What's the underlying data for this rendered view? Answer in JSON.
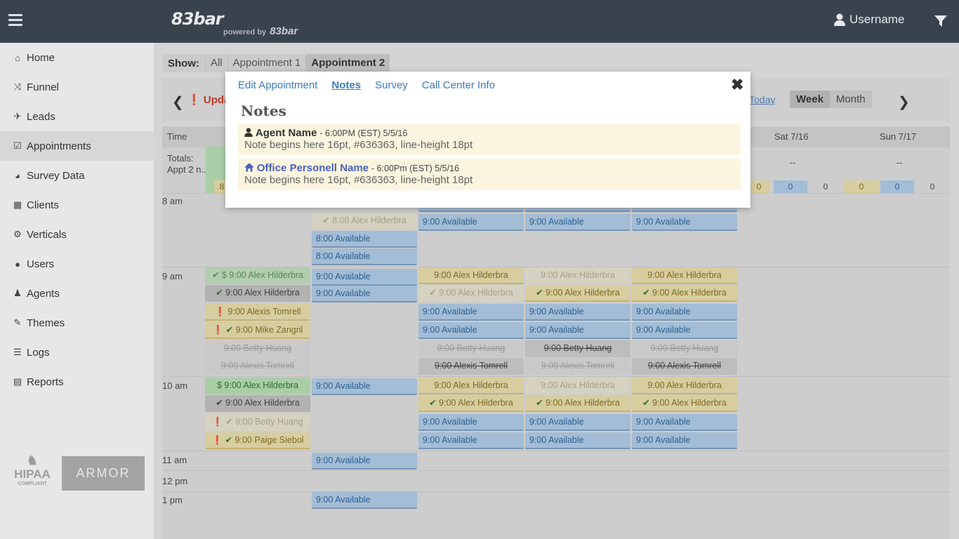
{
  "header": {
    "brand": "83bar",
    "powered_label": "powered by",
    "powered_brand": "83bar",
    "username": "Username",
    "menu_icon": "hamburger-icon",
    "user_icon": "user-icon",
    "filter_icon": "filter-icon"
  },
  "sidebar": {
    "items": [
      {
        "label": "Home",
        "icon": "home-icon"
      },
      {
        "label": "Funnel",
        "icon": "shuffle-icon"
      },
      {
        "label": "Leads",
        "icon": "plane-icon"
      },
      {
        "label": "Appointments",
        "icon": "calendar-check-icon"
      },
      {
        "label": "Survey Data",
        "icon": "pie-chart-icon"
      },
      {
        "label": "Clients",
        "icon": "building-icon"
      },
      {
        "label": "Verticals",
        "icon": "cogs-icon"
      },
      {
        "label": "Users",
        "icon": "users-icon"
      },
      {
        "label": "Agents",
        "icon": "user-tie-icon"
      },
      {
        "label": "Themes",
        "icon": "brush-icon"
      },
      {
        "label": "Logs",
        "icon": "list-icon"
      },
      {
        "label": "Reports",
        "icon": "file-icon"
      }
    ],
    "hipaa": "HIPAA",
    "hipaa_sub": "COMPLIANT",
    "armor": "ARMOR"
  },
  "show": {
    "label": "Show:",
    "options": [
      "All",
      "Appointment 1",
      "Appointment 2"
    ]
  },
  "calbar": {
    "update_text": "Upda",
    "today": "Today",
    "views": [
      "Week",
      "Month"
    ]
  },
  "grid": {
    "time_header": "Time",
    "day_headers": [
      "Sat 7/16",
      "Sun 7/17"
    ],
    "totals_label": "Totals:",
    "totals_sub": "Appt 2 n...",
    "dash": "--",
    "totals_values": [
      "0",
      "0",
      "0",
      "0",
      "0",
      "0"
    ],
    "partial_total": "8",
    "times": [
      "8 am",
      "9 am",
      "10 am",
      "11 am",
      "12 pm",
      "1 pm"
    ],
    "ev": {
      "a8a": "8:00 Alex Hilderbra",
      "av8": "8:00 Available",
      "av9": "9:00 Available",
      "alex": "9:00 Alex Hilderbra",
      "alexis": "9:00 Alexis Tomrell",
      "mike": "9:00 Mike Zangril",
      "betty": "9:00 Betty Huang",
      "paige": "9:00 Paige Siebol"
    }
  },
  "modal": {
    "tabs": [
      "Edit Appointment",
      "Notes",
      "Survey",
      "Call Center Info"
    ],
    "active_tab": "Notes",
    "title": "Notes",
    "notes": [
      {
        "author": "Agent Name",
        "meta": "- 6:00PM (EST) 5/5/16",
        "text": "Note begins here 16pt, #636363, line-height 18pt"
      },
      {
        "author": "Office Personell Name",
        "meta": "- 6:00Pm (EST) 5/5/16",
        "text": "Note begins here 16pt, #636363, line-height 18pt"
      }
    ]
  }
}
